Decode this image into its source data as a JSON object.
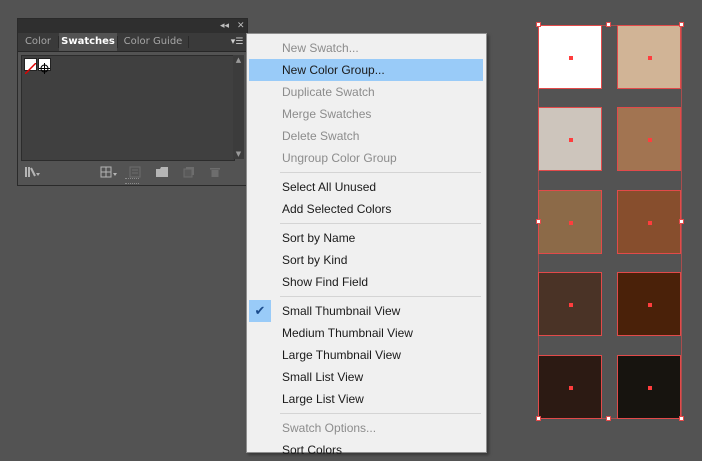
{
  "panel": {
    "tabs": [
      "Color",
      "Swatches",
      "Color Guide"
    ],
    "active_tab": "Swatches",
    "title_buttons": {
      "collapse": "◂◂",
      "close": "✕"
    },
    "menu_icon": "▾☰"
  },
  "menu": {
    "items": [
      {
        "label": "New Swatch...",
        "disabled": true
      },
      {
        "label": "New Color Group...",
        "disabled": false,
        "highlighted": true
      },
      {
        "label": "Duplicate Swatch",
        "disabled": true
      },
      {
        "label": "Merge Swatches",
        "disabled": true
      },
      {
        "label": "Delete Swatch",
        "disabled": true
      },
      {
        "label": "Ungroup Color Group",
        "disabled": true
      },
      {
        "label": "Select All Unused",
        "disabled": false
      },
      {
        "label": "Add Selected Colors",
        "disabled": false
      },
      {
        "label": "Sort by Name",
        "disabled": false
      },
      {
        "label": "Sort by Kind",
        "disabled": false
      },
      {
        "label": "Show Find Field",
        "disabled": false
      },
      {
        "label": "Small Thumbnail View",
        "disabled": false,
        "checked": true
      },
      {
        "label": "Medium Thumbnail View",
        "disabled": false
      },
      {
        "label": "Large Thumbnail View",
        "disabled": false
      },
      {
        "label": "Small List View",
        "disabled": false
      },
      {
        "label": "Large List View",
        "disabled": false
      },
      {
        "label": "Swatch Options...",
        "disabled": true
      },
      {
        "label": "Sort Colors",
        "disabled": false
      }
    ],
    "check_glyph": "✔"
  },
  "artboard_swatches": [
    "#ffffff",
    "#d1b496",
    "#cdc5bc",
    "#a27451",
    "#8c6a48",
    "#874e2d",
    "#4a3326",
    "#4a2109",
    "#2c1a13",
    "#17140f"
  ],
  "colors": {
    "selection": "#e24a4a",
    "menu_highlight": "#99cbf8"
  }
}
